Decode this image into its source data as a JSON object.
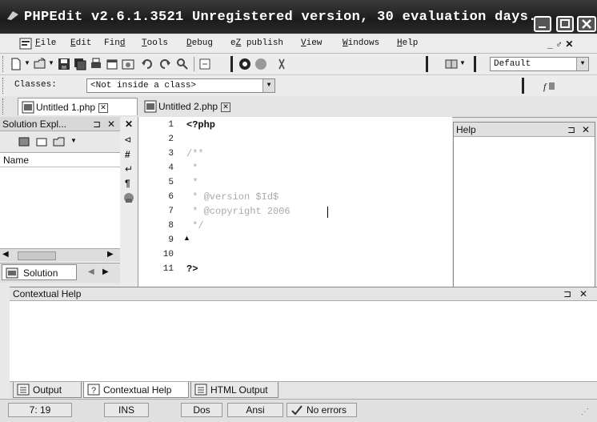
{
  "window": {
    "title": "PHPEdit v2.6.1.3521 Unregistered version, 30 evaluation days...",
    "buttons": {
      "minimize": "_",
      "maximize": "□",
      "close": "✕"
    }
  },
  "menubar": {
    "items": [
      {
        "label": "File",
        "accel": "F"
      },
      {
        "label": "Edit",
        "accel": "E"
      },
      {
        "label": "Find",
        "accel": "d"
      },
      {
        "label": "Tools",
        "accel": "T"
      },
      {
        "label": "Debug",
        "accel": "D"
      },
      {
        "label": "eZ publish",
        "accel": "Z"
      },
      {
        "label": "View",
        "accel": "V"
      },
      {
        "label": "Windows",
        "accel": "W"
      },
      {
        "label": "Help",
        "accel": "H"
      }
    ],
    "mdi_controls": "_ ♂ ✕"
  },
  "toolbar": {
    "config_combo": "Default",
    "classes_label": "Classes:",
    "classes_combo": "<Not inside a class>"
  },
  "doc_tabs": [
    {
      "label": "Untitled 1.php",
      "active": true
    },
    {
      "label": "Untitled 2.php",
      "active": false
    }
  ],
  "solution_explorer": {
    "title": "Solution Expl...",
    "pin": "⊐",
    "close": "✕",
    "column_name": "Name",
    "bottom_tab": "Solution"
  },
  "editor": {
    "lines": [
      {
        "n": "1",
        "text": "<?php",
        "style": "kw"
      },
      {
        "n": "2",
        "text": "",
        "style": "plain"
      },
      {
        "n": "3",
        "text": "/**",
        "style": "cmt"
      },
      {
        "n": "4",
        "text": " *",
        "style": "cmt"
      },
      {
        "n": "5",
        "text": " *",
        "style": "cmt"
      },
      {
        "n": "6",
        "text": " * @version $Id$",
        "style": "cmt"
      },
      {
        "n": "7",
        "text": " * @copyright 2006",
        "style": "cmt"
      },
      {
        "n": "8",
        "text": " */",
        "style": "cmt"
      },
      {
        "n": "9",
        "text": "",
        "style": "plain"
      },
      {
        "n": "10",
        "text": "",
        "style": "plain"
      },
      {
        "n": "11",
        "text": "?>",
        "style": "kw"
      }
    ]
  },
  "help_panel": {
    "title": "Help",
    "pin": "⊐",
    "close": "✕"
  },
  "contextual_help": {
    "title": "Contextual Help",
    "pin": "⊐",
    "close": "✕"
  },
  "bottom_tabs": [
    {
      "label": "Output",
      "active": false
    },
    {
      "label": "Contextual Help",
      "active": true
    },
    {
      "label": "HTML Output",
      "active": false
    }
  ],
  "statusbar": {
    "position": "7: 19",
    "mode": "INS",
    "line_ending": "Dos",
    "encoding": "Ansi",
    "errors": "No errors"
  }
}
